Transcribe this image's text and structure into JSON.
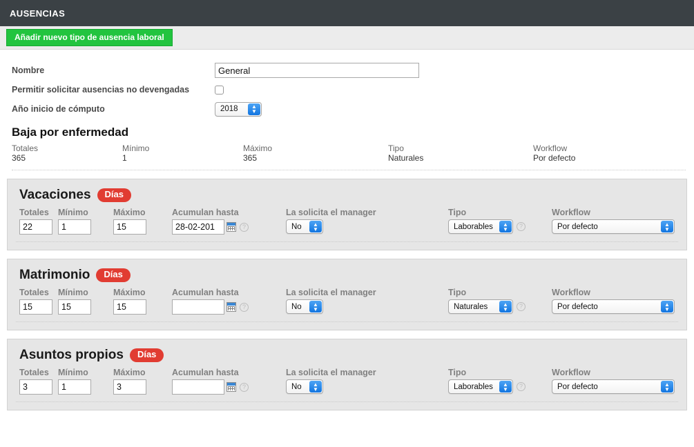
{
  "header": {
    "title": "AUSENCIAS"
  },
  "toolbar": {
    "add_button_label": "Añadir nuevo tipo de ausencia laboral"
  },
  "form": {
    "name_label": "Nombre",
    "name_value": "General",
    "allow_label": "Permitir solicitar ausencias no devengadas",
    "allow_checked": false,
    "year_label": "Año inicio de cómputo",
    "year_value": "2018"
  },
  "readonly_section": {
    "title": "Baja por enfermedad",
    "columns": [
      {
        "label": "Totales",
        "value": "365"
      },
      {
        "label": "Mínimo",
        "value": "1"
      },
      {
        "label": "Máximo",
        "value": "365"
      },
      {
        "label": "Tipo",
        "value": "Naturales"
      },
      {
        "label": "Workflow",
        "value": "Por defecto"
      }
    ]
  },
  "labels": {
    "totales": "Totales",
    "minimo": "Mínimo",
    "maximo": "Máximo",
    "acumulan": "Acumulan hasta",
    "manager": "La solicita el manager",
    "tipo": "Tipo",
    "workflow": "Workflow",
    "badge": "Días",
    "help": "?"
  },
  "panels": [
    {
      "title": "Vacaciones",
      "badge": "Días",
      "totales": "22",
      "minimo": "1",
      "maximo": "15",
      "acumulan": "28-02-201",
      "manager": "No",
      "tipo": "Laborables",
      "workflow": "Por defecto"
    },
    {
      "title": "Matrimonio",
      "badge": "Días",
      "totales": "15",
      "minimo": "15",
      "maximo": "15",
      "acumulan": "",
      "manager": "No",
      "tipo": "Naturales",
      "workflow": "Por defecto"
    },
    {
      "title": "Asuntos propios",
      "badge": "Días",
      "totales": "3",
      "minimo": "1",
      "maximo": "3",
      "acumulan": "",
      "manager": "No",
      "tipo": "Laborables",
      "workflow": "Por defecto"
    }
  ],
  "colors": {
    "header_bg": "#3b4145",
    "add_button": "#22c43f",
    "badge_red": "#e13c32",
    "stepper_blue": "#1275e0",
    "panel_bg": "#e6e6e6"
  }
}
